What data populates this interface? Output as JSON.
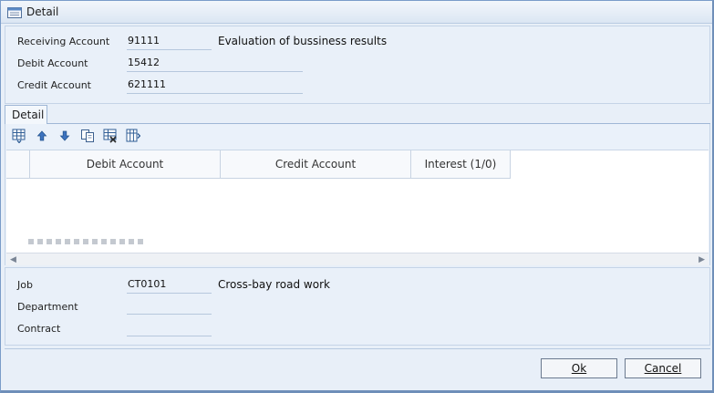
{
  "window": {
    "title": "Detail",
    "icon": "calendar-icon"
  },
  "header_fields": {
    "receiving_account": {
      "label": "Receiving Account",
      "value": "91111",
      "description": "Evaluation of bussiness results"
    },
    "debit_account": {
      "label": "Debit Account",
      "value": "15412"
    },
    "credit_account": {
      "label": "Credit Account",
      "value": "621111"
    }
  },
  "tabs": [
    {
      "label": "Detail"
    }
  ],
  "toolbar": {
    "icons": [
      "insert-row-icon",
      "move-up-icon",
      "move-down-icon",
      "copy-icon",
      "delete-row-icon",
      "columns-icon"
    ]
  },
  "grid": {
    "columns": [
      "Debit Account",
      "Credit Account",
      "Interest (1/0)"
    ],
    "rows": []
  },
  "footer_fields": {
    "job": {
      "label": "Job",
      "value": "CT0101",
      "description": "Cross-bay road work"
    },
    "department": {
      "label": "Department",
      "value": ""
    },
    "contract": {
      "label": "Contract",
      "value": ""
    }
  },
  "buttons": {
    "ok": "Ok",
    "cancel": "Cancel"
  }
}
